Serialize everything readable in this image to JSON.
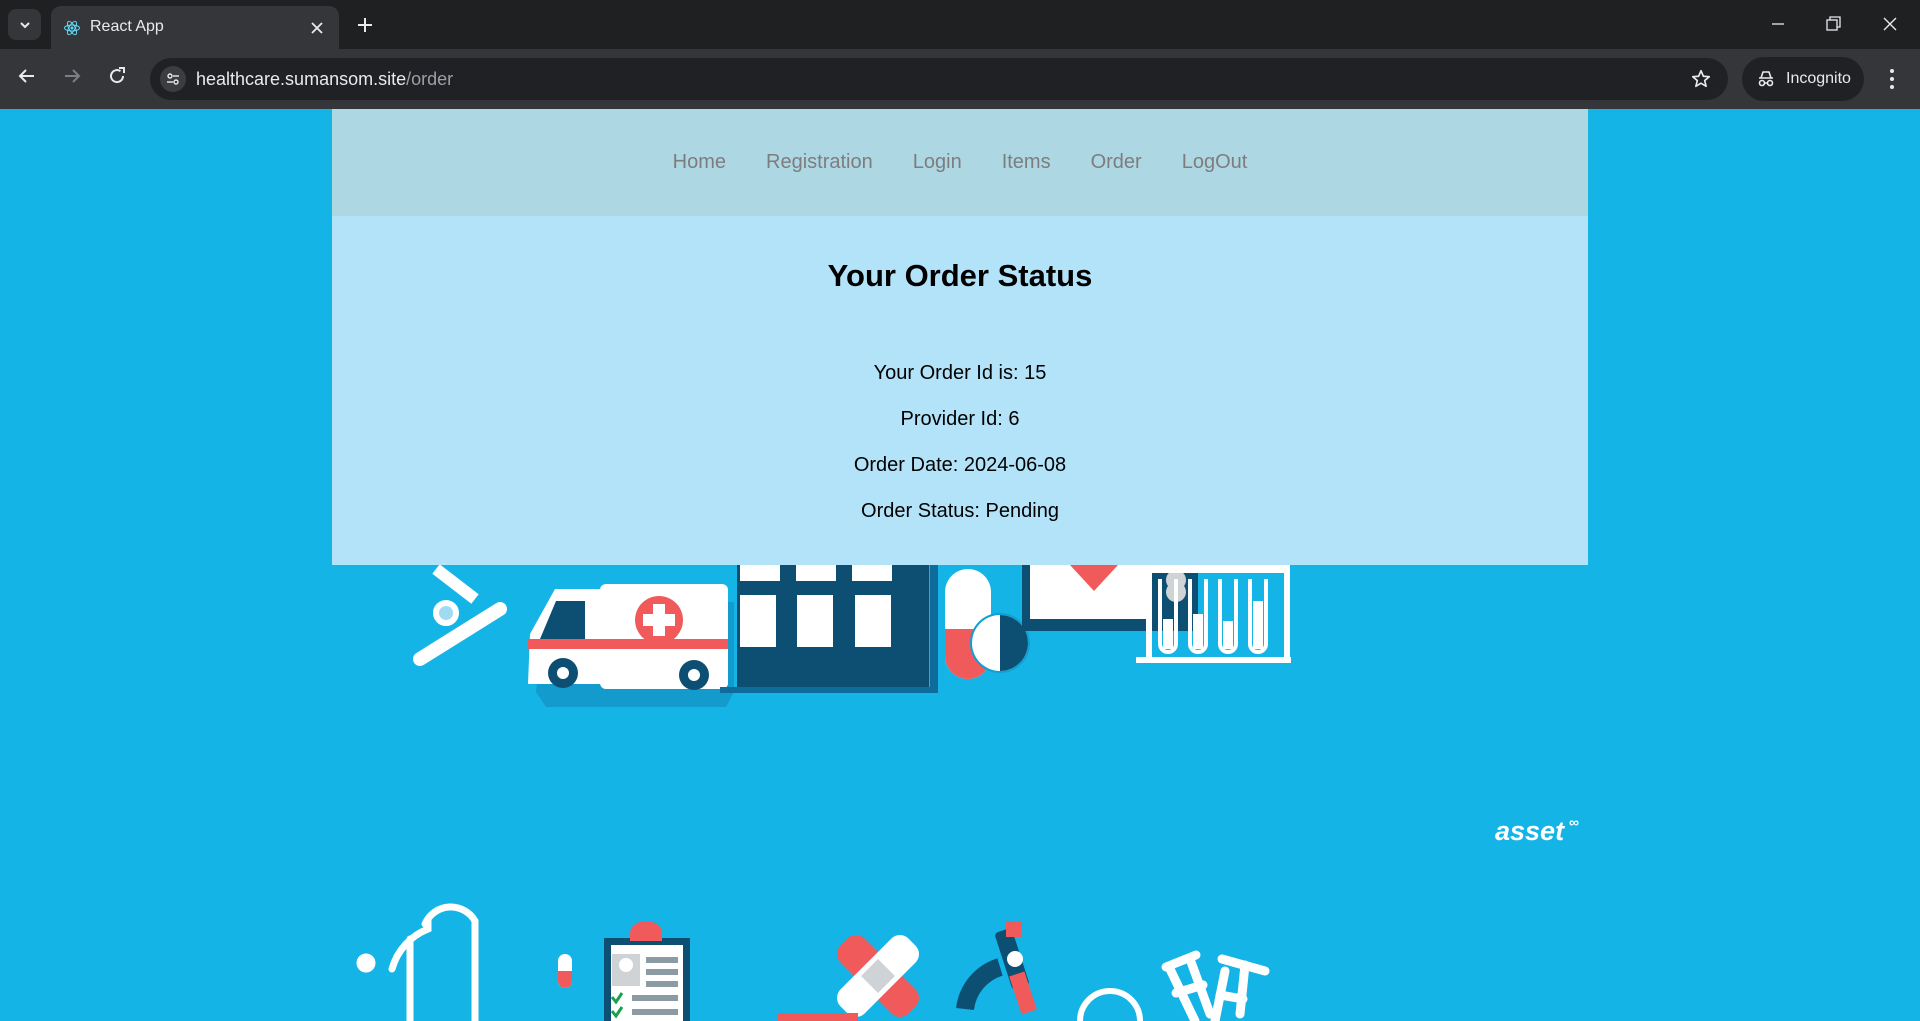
{
  "browser": {
    "tab_title": "React App",
    "url_host": "healthcare.sumansom.site",
    "url_path": "/order",
    "incognito_label": "Incognito"
  },
  "nav": {
    "links": [
      "Home",
      "Registration",
      "Login",
      "Items",
      "Order",
      "LogOut"
    ]
  },
  "order": {
    "heading": "Your Order Status",
    "order_id": "Your Order Id is: 15",
    "provider_id": "Provider Id: 6",
    "order_date": "Order Date: 2024-06-08",
    "order_status": "Order Status: Pending"
  },
  "watermark": "asset",
  "colors": {
    "page_bg": "#15b4e6",
    "navbar_bg": "#aed7e4",
    "card_bg": "#b3e3f9",
    "accent_red": "#f05a5b",
    "dark_navy": "#0d4f72"
  }
}
